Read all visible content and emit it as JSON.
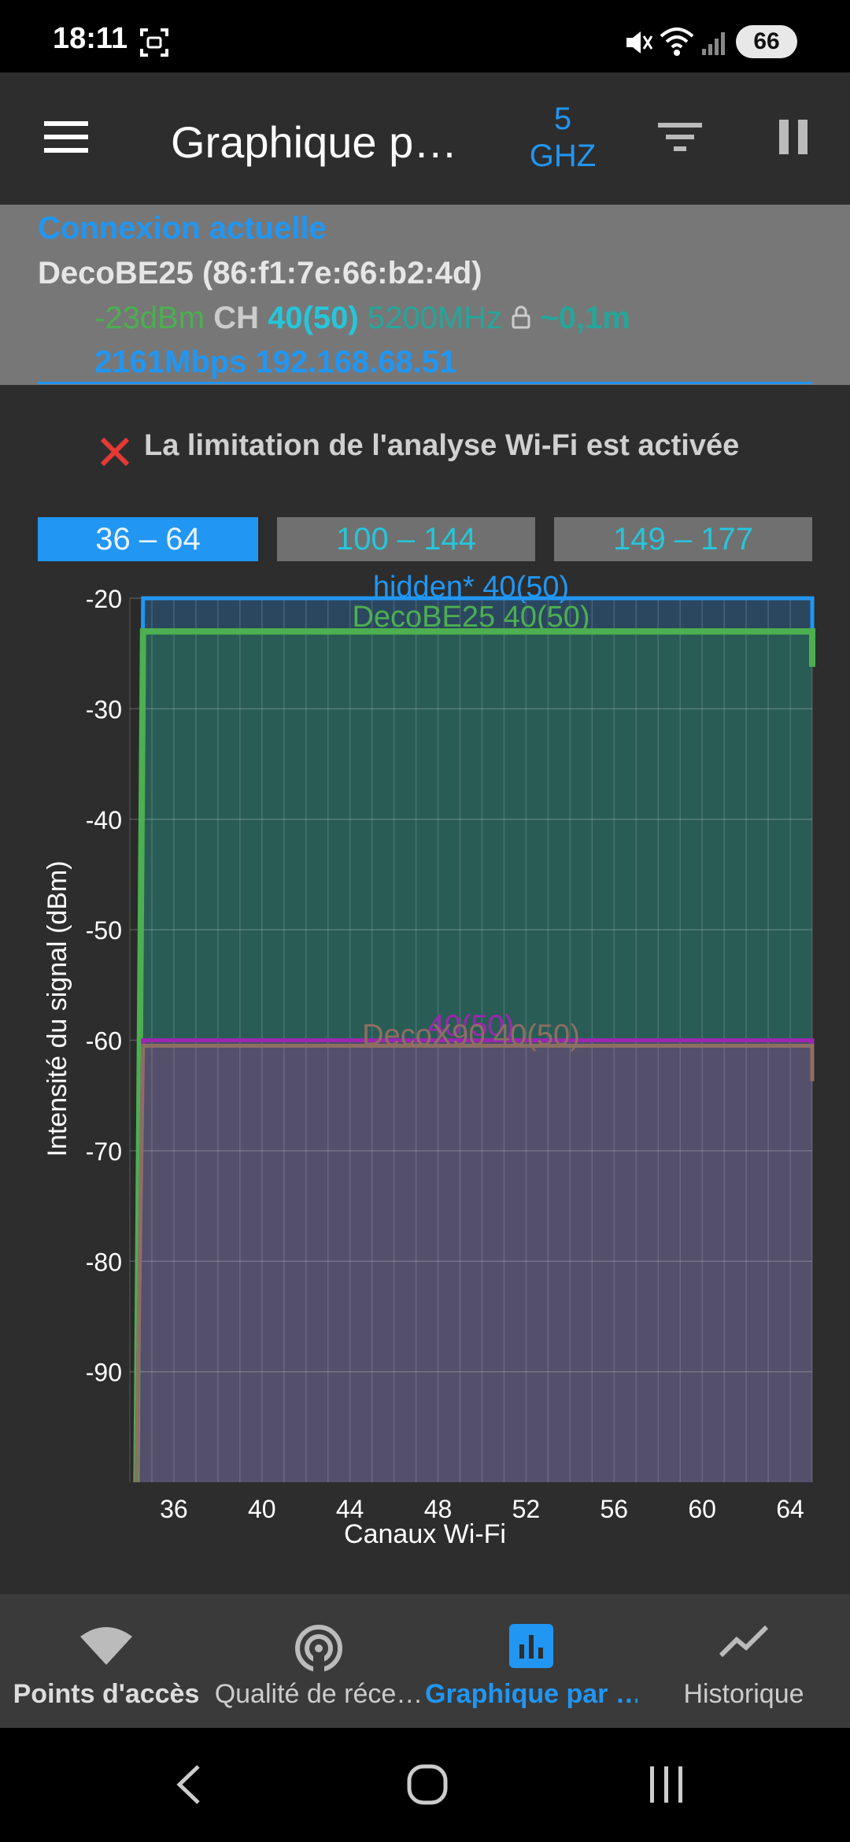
{
  "status": {
    "time": "18:11",
    "battery": "66"
  },
  "appbar": {
    "title": "Graphique p…",
    "band_line1": "5",
    "band_line2": "GHZ"
  },
  "connection": {
    "heading": "Connexion actuelle",
    "ssid_mac": "DecoBE25 (86:f1:7e:66:b2:4d)",
    "signal": "-23dBm",
    "ch_label": "CH",
    "channel": "40(50)",
    "frequency": "5200MHz",
    "distance": "~0,1m",
    "speed": "2161Mbps",
    "ip": "192.168.68.51"
  },
  "warning": {
    "text": "La limitation de l'analyse Wi-Fi est activée"
  },
  "range_tabs": [
    {
      "label": "36 – 64",
      "selected": true
    },
    {
      "label": "100 – 144",
      "selected": false
    },
    {
      "label": "149 – 177",
      "selected": false
    }
  ],
  "chart_data": {
    "type": "area",
    "xlabel": "Canaux Wi-Fi",
    "ylabel": "Intensité du signal (dBm)",
    "x_ticks": [
      "36",
      "40",
      "44",
      "48",
      "52",
      "56",
      "60",
      "64"
    ],
    "y_ticks": [
      "-20",
      "-30",
      "-40",
      "-50",
      "-60",
      "-70",
      "-80",
      "-90"
    ],
    "xlim": [
      34,
      65
    ],
    "ylim": [
      -100,
      -20
    ],
    "grid": true,
    "series": [
      {
        "name": "hidden* 40(50)",
        "color": "#2196f3",
        "level": -20,
        "fill": "#2b4a66"
      },
      {
        "name": "DecoBE25 40(50)",
        "color": "#4caf50",
        "level": -23,
        "fill": "#2a5e55"
      },
      {
        "name": "40(50)",
        "color": "#9c27b0",
        "level": -60,
        "fill": "#4e4d6a"
      },
      {
        "name": "DecoX90 40(50)",
        "color": "#8d6e63",
        "level": -60.5,
        "fill": "#55506a"
      }
    ]
  },
  "bottom_nav": [
    {
      "label": "Points d'accès",
      "icon": "wifi-icon",
      "active": false
    },
    {
      "label": "Qualité de réce…",
      "icon": "signal-quality-icon",
      "active": false
    },
    {
      "label": "Graphique par …",
      "icon": "bar-chart-icon",
      "active": true
    },
    {
      "label": "Historique",
      "icon": "trend-icon",
      "active": false
    }
  ],
  "colors": {
    "accent": "#2196f3",
    "green": "#4caf50",
    "teal": "#26a69a"
  }
}
